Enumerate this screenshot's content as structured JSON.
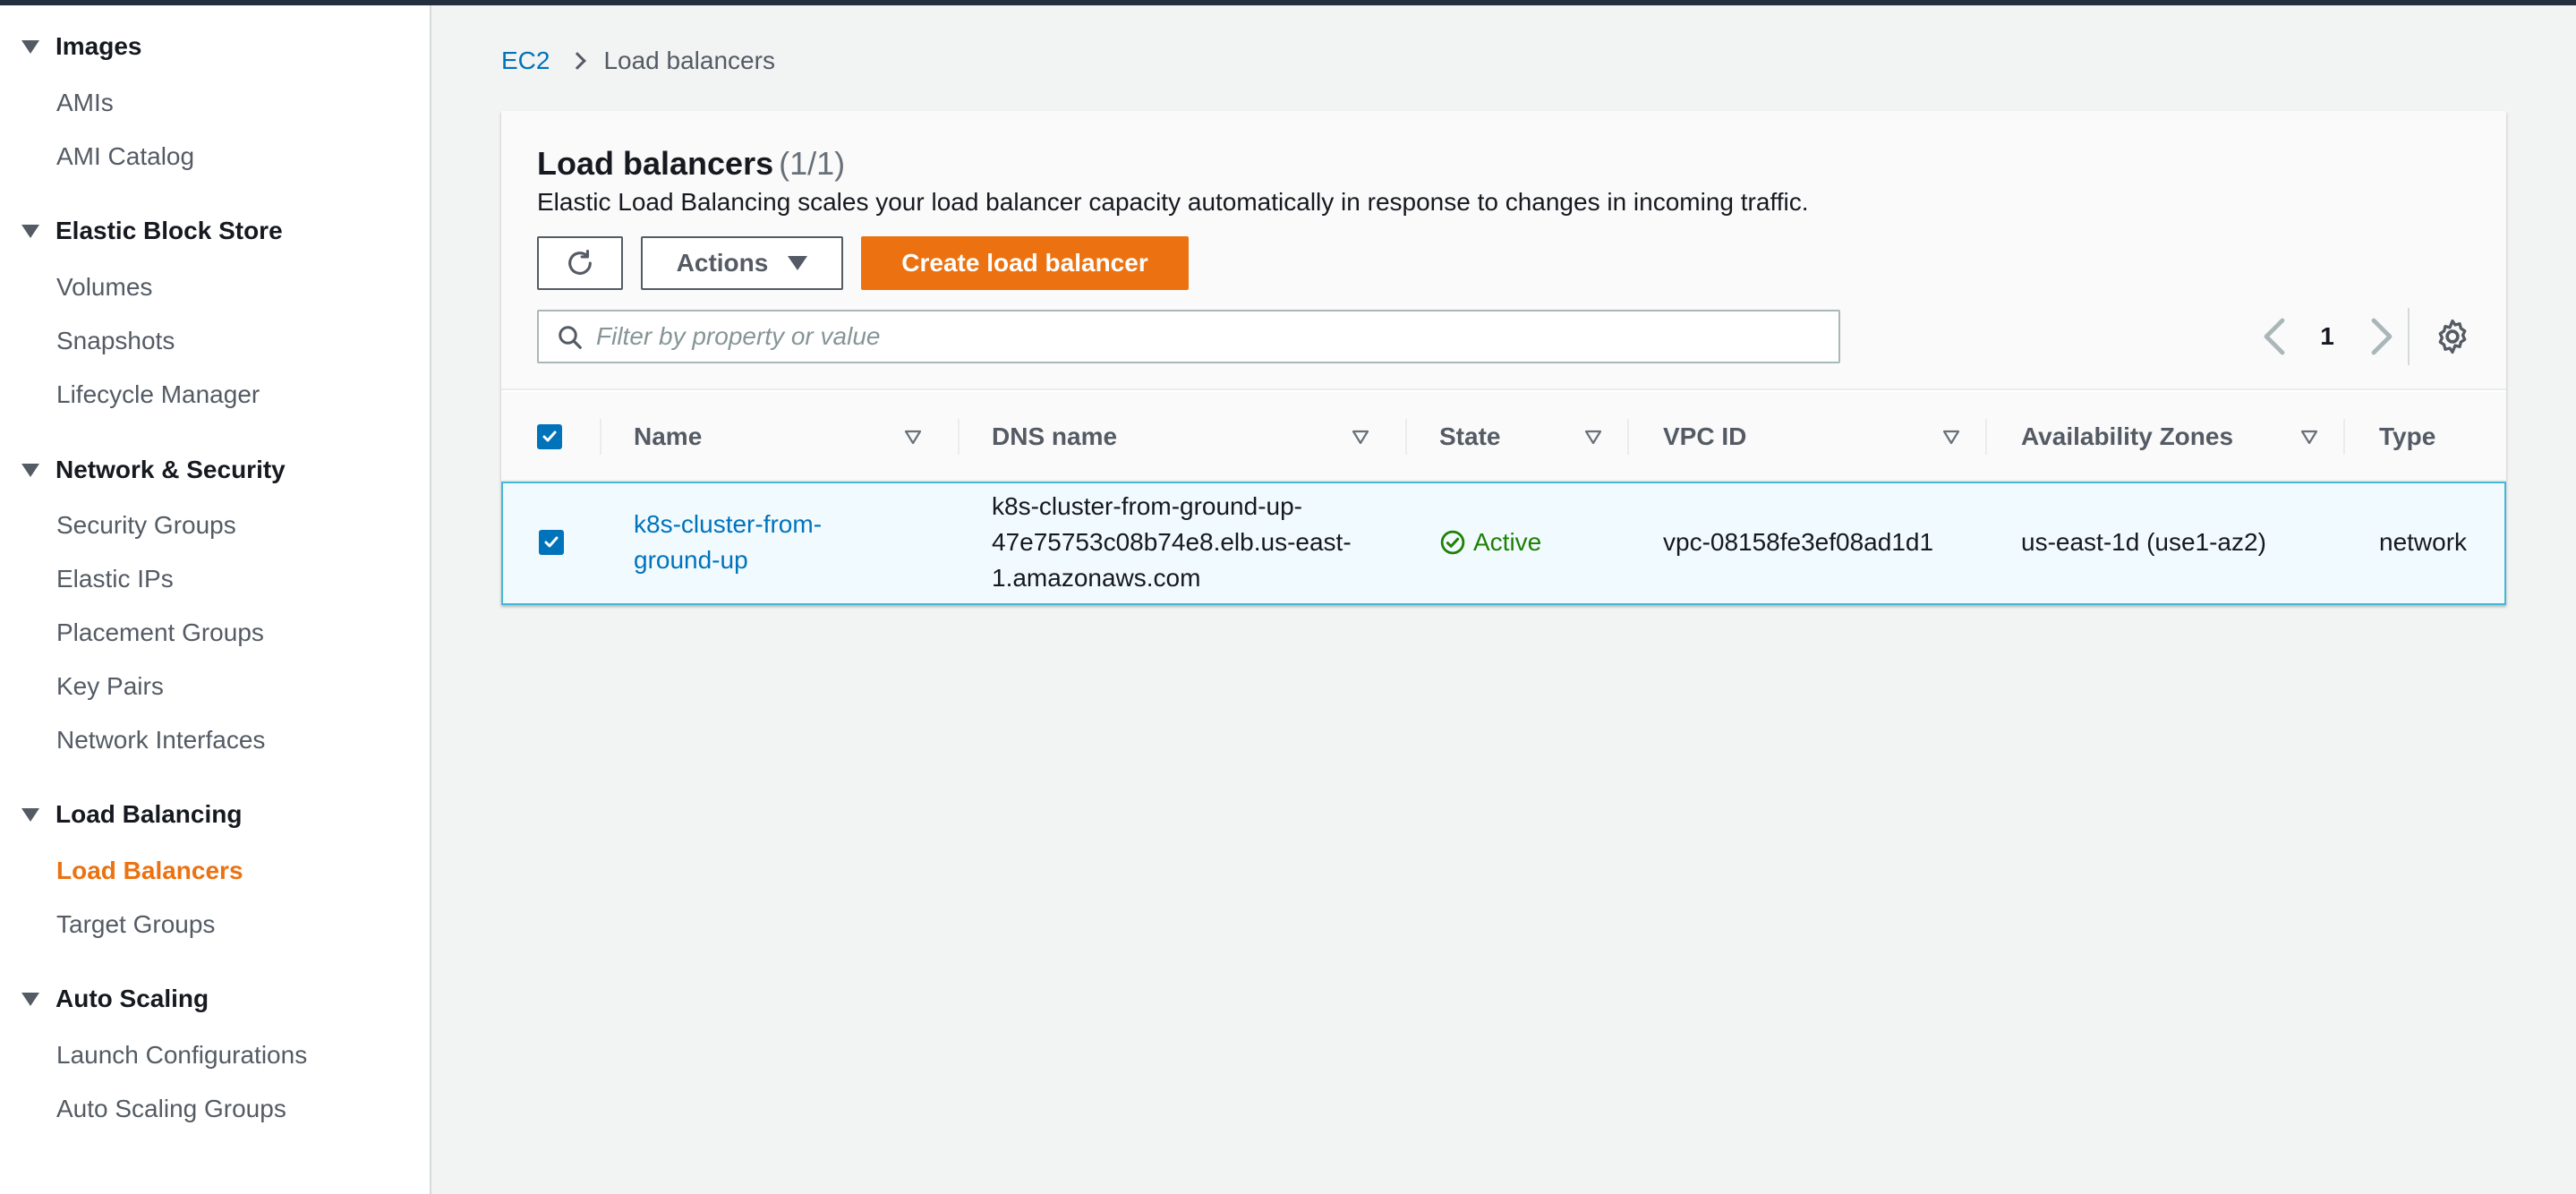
{
  "sidebar": {
    "sections": [
      {
        "header": "Images",
        "items": [
          "AMIs",
          "AMI Catalog"
        ]
      },
      {
        "header": "Elastic Block Store",
        "items": [
          "Volumes",
          "Snapshots",
          "Lifecycle Manager"
        ]
      },
      {
        "header": "Network & Security",
        "items": [
          "Security Groups",
          "Elastic IPs",
          "Placement Groups",
          "Key Pairs",
          "Network Interfaces"
        ]
      },
      {
        "header": "Load Balancing",
        "items": [
          "Load Balancers",
          "Target Groups"
        ]
      },
      {
        "header": "Auto Scaling",
        "items": [
          "Launch Configurations",
          "Auto Scaling Groups"
        ]
      }
    ],
    "active_item": "Load Balancers"
  },
  "breadcrumb": {
    "root": "EC2",
    "current": "Load balancers"
  },
  "panel": {
    "title": "Load balancers",
    "count": "(1/1)",
    "description": "Elastic Load Balancing scales your load balancer capacity automatically in response to changes in incoming traffic.",
    "actions_label": "Actions",
    "create_label": "Create load balancer",
    "filter_placeholder": "Filter by property or value",
    "page": "1"
  },
  "table": {
    "columns": [
      "Name",
      "DNS name",
      "State",
      "VPC ID",
      "Availability Zones",
      "Type"
    ],
    "rows": [
      {
        "name_line1": "k8s-cluster-from-",
        "name_line2": "ground-up",
        "dns_line1": "k8s-cluster-from-ground-up-",
        "dns_line2": "47e75753c08b74e8.elb.us-east-",
        "dns_line3": "1.amazonaws.com",
        "state": "Active",
        "vpc_id": "vpc-08158fe3ef08ad1d1",
        "az": "us-east-1d (use1-az2)",
        "type": "network",
        "selected": true
      }
    ]
  },
  "colors": {
    "accent": "#ec7211",
    "link": "#0073bb",
    "success": "#1d8102",
    "selected_row": "#f1faff"
  }
}
